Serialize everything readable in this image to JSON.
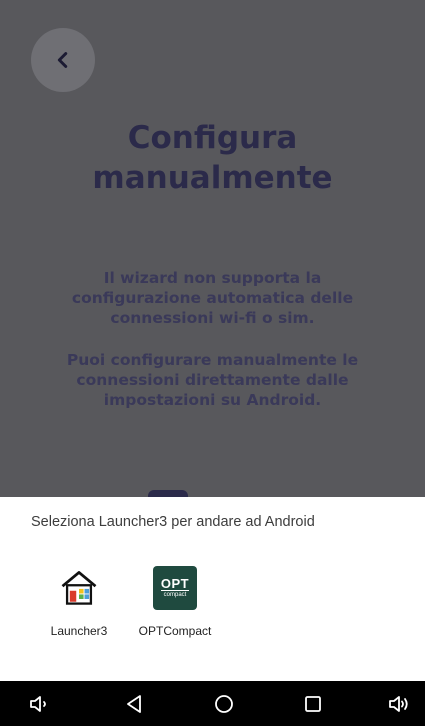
{
  "screen": {
    "title_line1": "Configura",
    "title_line2": "manualmente",
    "paragraph1": "Il wizard non supporta la configurazione automatica delle connessioni wi-fi o sim.",
    "paragraph2": "Puoi configurare manualmente le connessioni direttamente dalle impostazioni su Android."
  },
  "chooser": {
    "title": "Seleziona Launcher3 per andare ad Android",
    "apps": [
      {
        "label": "Launcher3",
        "icon": "house-icon"
      },
      {
        "label": "OPTCompact",
        "icon": "opt-compact-icon",
        "icon_text_top": "OPT",
        "icon_text_bottom": "compact"
      }
    ]
  },
  "navbar": {
    "icons": [
      "volume-down-icon",
      "back-triangle-icon",
      "home-circle-icon",
      "recents-square-icon",
      "volume-up-icon"
    ]
  },
  "colors": {
    "overlay_bg": "#58585c",
    "title_color": "#2b2a4a",
    "opt_green": "#1f4a3f",
    "navbar_bg": "#000000"
  }
}
